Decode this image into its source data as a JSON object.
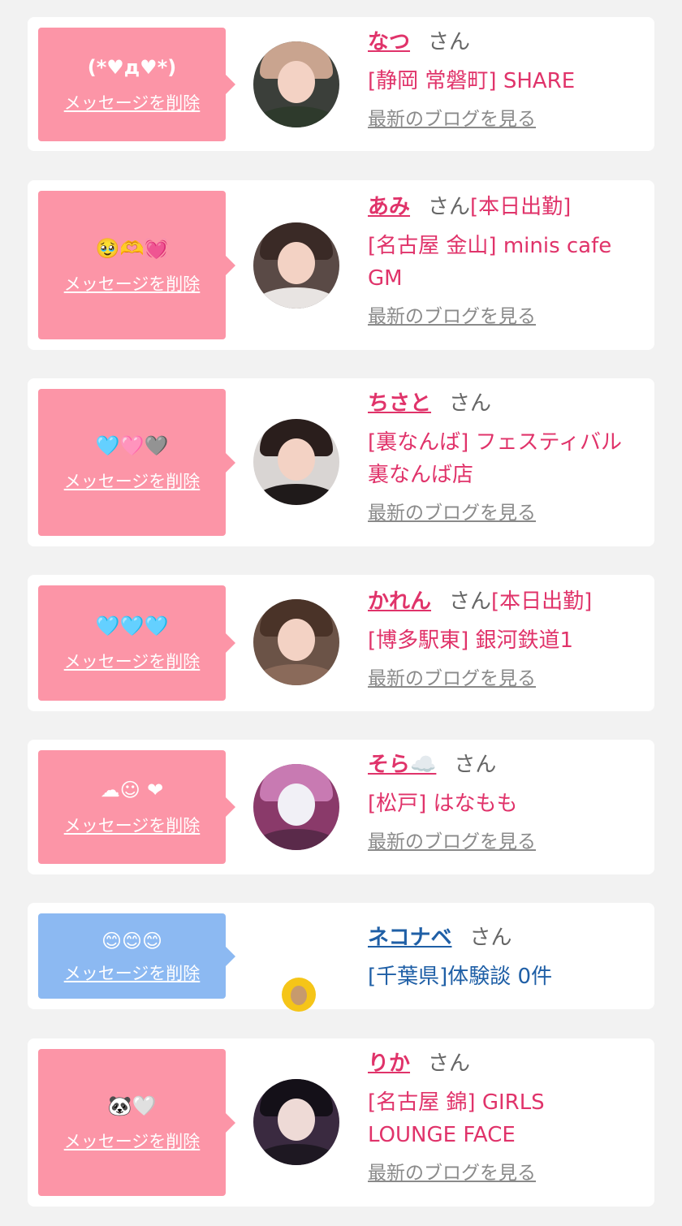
{
  "cards": [
    {
      "message": "(*♥д♥*)",
      "delete_label": "メッセージを削除",
      "name": "なつ",
      "honorific": "さん",
      "status": "",
      "shop": "[静岡 常磐町] SHARE",
      "blog_link": "最新のブログを見る",
      "avatar_colors": {
        "bg": "#3b3f3a",
        "hair": "#c9a48f",
        "body": "#2e3a2c"
      }
    },
    {
      "message": "🥹🫶💓",
      "delete_label": "メッセージを削除",
      "name": "あみ",
      "honorific": "さん",
      "status": "[本日出勤]",
      "shop": "[名古屋 金山] minis cafe GM",
      "blog_link": "最新のブログを見る",
      "avatar_colors": {
        "bg": "#5a4a46",
        "hair": "#3a2a26",
        "body": "#e8e4e2"
      }
    },
    {
      "message": "🩵🩷🩶",
      "delete_label": "メッセージを削除",
      "name": "ちさと",
      "honorific": "さん",
      "status": "",
      "shop": "[裏なんば] フェスティバル裏なんば店",
      "blog_link": "最新のブログを見る",
      "avatar_colors": {
        "bg": "#d9d5d3",
        "hair": "#2a1e1c",
        "body": "#1f1a1a"
      }
    },
    {
      "message": "🩵🩵🩵",
      "delete_label": "メッセージを削除",
      "name": "かれん",
      "honorific": "さん",
      "status": "[本日出勤]",
      "shop": "[博多駅東] 銀河鉄道1",
      "blog_link": "最新のブログを見る",
      "avatar_colors": {
        "bg": "#6b5347",
        "hair": "#4a3328",
        "body": "#8a6a5a"
      }
    },
    {
      "message": "☁︎☺︎ ❤︎",
      "delete_label": "メッセージを削除",
      "name": "そら☁️",
      "honorific": "さん",
      "status": "",
      "shop": "[松戸] はなもも",
      "blog_link": "最新のブログを見る",
      "avatar_colors": {
        "bg": "#8a3a6a",
        "hair": "#c87ab2",
        "body": "#5a2a4a"
      }
    },
    {
      "message": "😊😊😊",
      "delete_label": "メッセージを削除",
      "name": "ネコナベ",
      "honorific": "さん",
      "status": "",
      "shop": "[千葉県]体験談 0件",
      "blog_link": "",
      "avatar_colors": {
        "bg": "#f5c518",
        "hair": "#c79a6d",
        "body": "#f5c518"
      }
    },
    {
      "message": "🐼🤍",
      "delete_label": "メッセージを削除",
      "name": "りか",
      "honorific": "さん",
      "status": "",
      "shop": "[名古屋 錦] GIRLS LOUNGE FACE",
      "blog_link": "最新のブログを見る",
      "avatar_colors": {
        "bg": "#3a2a40",
        "hair": "#141018",
        "body": "#1e1822"
      }
    }
  ]
}
